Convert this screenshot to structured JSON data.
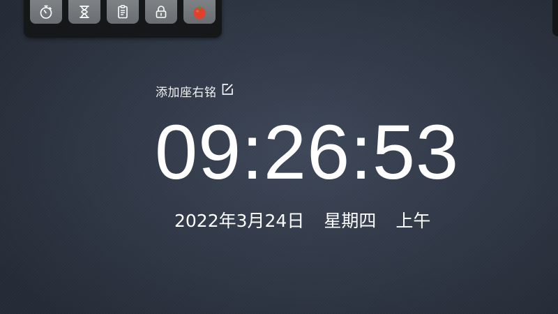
{
  "toolbar": {
    "items": [
      {
        "icon": "stopwatch-icon"
      },
      {
        "icon": "hourglass-icon"
      },
      {
        "icon": "clipboard-icon"
      },
      {
        "icon": "lock-icon"
      },
      {
        "icon": "tomato-icon"
      }
    ]
  },
  "motto": {
    "label": "添加座右铭",
    "icon": "edit-icon"
  },
  "clock": {
    "time": "09:26:53"
  },
  "date": {
    "date": "2022年3月24日",
    "weekday": "星期四",
    "period": "上午"
  },
  "colors": {
    "background": "#323a49",
    "toolbar": "#151719",
    "button": "#74787c",
    "text": "#ffffff",
    "tomato": "#e0402c"
  }
}
